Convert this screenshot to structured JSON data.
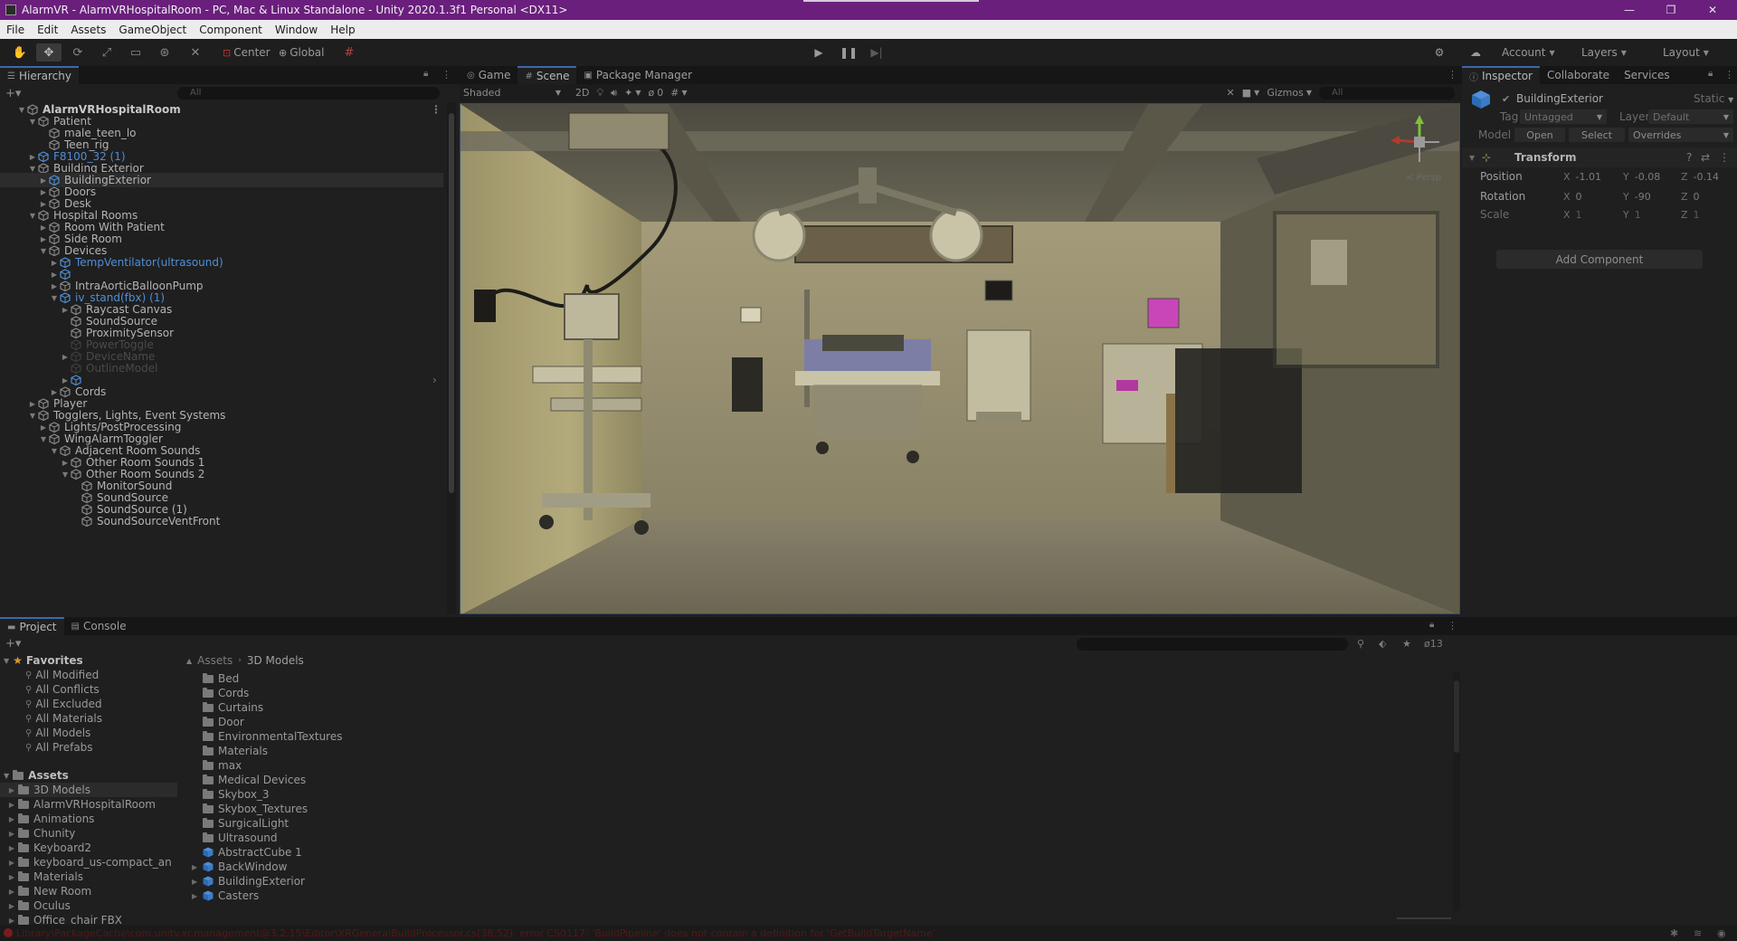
{
  "titlebar": {
    "title": "AlarmVR - AlarmVRHospitalRoom - PC, Mac & Linux Standalone - Unity 2020.1.3f1 Personal <DX11>",
    "minimize": "—",
    "restore": "❐",
    "close": "✕"
  },
  "menu": [
    "File",
    "Edit",
    "Assets",
    "GameObject",
    "Component",
    "Window",
    "Help"
  ],
  "toolbar": {
    "pivot_label": "Center",
    "space_label": "Global",
    "account_label": "Account",
    "layers_label": "Layers",
    "layout_label": "Layout"
  },
  "hierarchy": {
    "tab_label": "Hierarchy",
    "search_placeholder": "All",
    "rows": [
      {
        "label": "AlarmVRHospitalRoom",
        "kind": "root"
      },
      {
        "label": "Patient",
        "kind": "normal"
      },
      {
        "label": "male_teen_lo",
        "kind": "normal"
      },
      {
        "label": "Teen_rig",
        "kind": "normal"
      },
      {
        "label": "F8100_32 (1)",
        "kind": "prefab"
      },
      {
        "label": "Building Exterior",
        "kind": "normal"
      },
      {
        "label": "BuildingExterior",
        "kind": "selected"
      },
      {
        "label": "Doors",
        "kind": "normal"
      },
      {
        "label": "Desk",
        "kind": "normal"
      },
      {
        "label": "Hospital Rooms",
        "kind": "normal"
      },
      {
        "label": "Room With Patient",
        "kind": "normal"
      },
      {
        "label": "Side Room",
        "kind": "normal"
      },
      {
        "label": "Devices",
        "kind": "normal"
      },
      {
        "label": "TempVentilator(ultrasound)",
        "kind": "prefab"
      },
      {
        "label": "",
        "kind": "dim-prefab"
      },
      {
        "label": "IntraAorticBalloonPump",
        "kind": "normal"
      },
      {
        "label": "iv_stand(fbx) (1)",
        "kind": "prefab"
      },
      {
        "label": "Raycast Canvas",
        "kind": "normal"
      },
      {
        "label": "SoundSource",
        "kind": "normal"
      },
      {
        "label": "ProximitySensor",
        "kind": "normal"
      },
      {
        "label": "PowerToggle",
        "kind": "dim"
      },
      {
        "label": "DeviceName",
        "kind": "dim"
      },
      {
        "label": "OutlineModel",
        "kind": "dim"
      },
      {
        "label": "",
        "kind": "dim-prefab"
      },
      {
        "label": "Cords",
        "kind": "normal"
      },
      {
        "label": "Player",
        "kind": "normal"
      },
      {
        "label": "Togglers, Lights, Event Systems",
        "kind": "normal"
      },
      {
        "label": "Lights/PostProcessing",
        "kind": "normal"
      },
      {
        "label": "WingAlarmToggler",
        "kind": "normal"
      },
      {
        "label": "Adjacent Room Sounds",
        "kind": "normal"
      },
      {
        "label": "Other Room Sounds 1",
        "kind": "normal"
      },
      {
        "label": "Other Room Sounds 2",
        "kind": "normal"
      },
      {
        "label": "MonitorSound",
        "kind": "normal"
      },
      {
        "label": "SoundSource",
        "kind": "normal"
      },
      {
        "label": "SoundSource (1)",
        "kind": "normal"
      },
      {
        "label": "SoundSourceVentFront",
        "kind": "normal"
      }
    ]
  },
  "scene": {
    "tabs": [
      "Game",
      "Scene",
      "Package Manager"
    ],
    "shading_mode": "Shaded",
    "mode_2d": "2D",
    "hidden_count": "0",
    "gizmos_label": "Gizmos",
    "persp_label": "< Persp"
  },
  "inspector": {
    "tabs": [
      "Inspector",
      "Collaborate",
      "Services"
    ],
    "object_name": "BuildingExterior",
    "static_label": "Static",
    "tag_label": "Tag",
    "tag_value": "Untagged",
    "layer_label": "Layer",
    "layer_value": "Default",
    "model_label": "Model",
    "open_label": "Open",
    "select_label": "Select",
    "overrides_label": "Overrides",
    "transform_label": "Transform",
    "position_label": "Position",
    "rotation_label": "Rotation",
    "scale_label": "Scale",
    "position": {
      "x": "-1.01",
      "y": "-0.08",
      "z": "-0.14"
    },
    "rotation": {
      "x": "0",
      "y": "-90",
      "z": "0"
    },
    "scale": {
      "x": "1",
      "y": "1",
      "z": "1"
    },
    "add_component_label": "Add Component"
  },
  "project": {
    "tabs": [
      "Project",
      "Console"
    ],
    "favorites_label": "Favorites",
    "favorites": [
      "All Modified",
      "All Conflicts",
      "All Excluded",
      "All Materials",
      "All Models",
      "All Prefabs"
    ],
    "assets_label": "Assets",
    "asset_folders": [
      "3D Models",
      "AlarmVRHospitalRoom",
      "Animations",
      "Chunity",
      "Keyboard2",
      "keyboard_us-compact_an",
      "Materials",
      "New Room",
      "Oculus",
      "Office_chair FBX"
    ],
    "breadcrumb_root": "Assets",
    "breadcrumb_current": "3D Models",
    "hidden_count": "13",
    "items": [
      {
        "label": "Bed",
        "type": "folder"
      },
      {
        "label": "Cords",
        "type": "folder"
      },
      {
        "label": "Curtains",
        "type": "folder"
      },
      {
        "label": "Door",
        "type": "folder"
      },
      {
        "label": "EnvironmentalTextures",
        "type": "folder"
      },
      {
        "label": "Materials",
        "type": "folder"
      },
      {
        "label": "max",
        "type": "folder"
      },
      {
        "label": "Medical Devices",
        "type": "folder"
      },
      {
        "label": "Skybox_3",
        "type": "folder"
      },
      {
        "label": "Skybox_Textures",
        "type": "folder"
      },
      {
        "label": "SurgicalLight",
        "type": "folder"
      },
      {
        "label": "Ultrasound",
        "type": "folder"
      },
      {
        "label": "AbstractCube 1",
        "type": "prefab"
      },
      {
        "label": "BackWindow",
        "type": "prefab"
      },
      {
        "label": "BuildingExterior",
        "type": "prefab"
      },
      {
        "label": "Casters",
        "type": "prefab"
      }
    ]
  },
  "status": {
    "message": "Library\\PackageCache\\com.unity.xr.management@3.2.15\\Editor\\XRGeneralBuildProcessor.cs(38,52): error CS0117: 'BuildPipeline' does not contain a definition for 'GetBuildTargetName'"
  },
  "colors": {
    "titlebar": "#6a1f7d",
    "prefab_blue": "#4f8ed8",
    "selection": "#2c4f7a"
  }
}
